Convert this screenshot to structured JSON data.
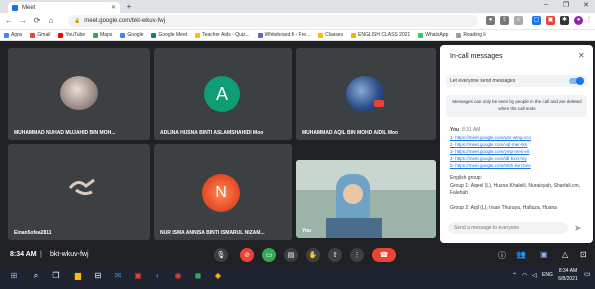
{
  "browser": {
    "tab_title": "Meet",
    "url": "meet.google.com/bkt-wkuv-fwj",
    "bookmarks": [
      "Apps",
      "Gmail",
      "YouTube",
      "Maps",
      "Google",
      "Google Meet",
      "Teacher Aids - Quiz...",
      "Whiteboard.fi - Fre...",
      "Classes",
      "ENGLISH CLASS 2021",
      "WhatsApp",
      "Reading li"
    ]
  },
  "tiles": [
    {
      "name": "MUHAMMAD NUHAD MUJAHID BIN MOH..."
    },
    {
      "name": "ADLINA HUSNA BINTI ASLAMSHAHIDI Moo",
      "initial": "A"
    },
    {
      "name": "MUHAMMAD AQIL BIN MOHD AIDIL Moo"
    },
    {
      "name": "Einan5ofea2811"
    },
    {
      "name": "NUR ISMA ANNISA BINTI ISMARUL NIZAM...",
      "initial": "N"
    },
    {
      "name": "You"
    }
  ],
  "panel": {
    "title": "In-call messages",
    "toggle_label": "Let everyone send messages",
    "notice": "Messages can only be seen by people in the call and are deleted when the call ends",
    "sender": "You",
    "time": "8:31 AM",
    "links": [
      "1- https://meet.google.com/wsr-wtng-cco",
      "2- https://meet.google.com/vqf-mer-tkn",
      "3- https://meet.google.com/ymp-mes-eit",
      "4- https://meet.google.com/tdl-bxxt-hnj",
      "5- https://meet.google.com/mbh-ksn-bne"
    ],
    "group_heading": "English group:",
    "group1": "Group 1: Aqeel (L), Husna Khaleili, Nuraisyah, Sharfali.cm, Falehah",
    "group2": "Group 2: Aqil (L), Irsan Thuraya, Hafiuza, Husna",
    "input_placeholder": "Send a message to everyone"
  },
  "controls": {
    "time": "8:34 AM",
    "meeting_code": "bkt-wkuv-fwj"
  },
  "taskbar": {
    "clock_time": "8:34 AM",
    "clock_date": "6/8/2021",
    "lang": "ENG"
  },
  "colors": {
    "avatar_a": "#0f9d74",
    "avatar_n": "#e8502a",
    "end_call": "#ea4335",
    "toggle": "#1a73e8"
  }
}
